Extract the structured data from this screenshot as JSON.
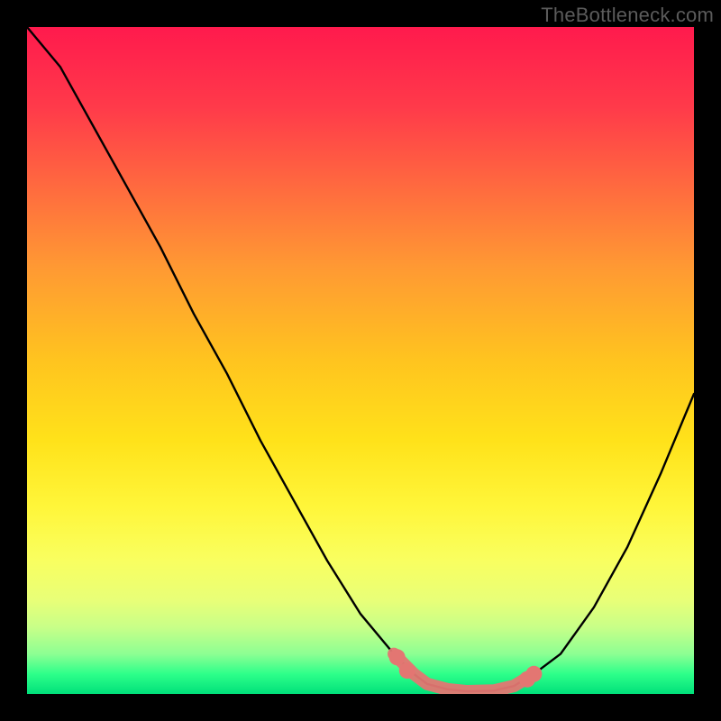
{
  "watermark": "TheBottleneck.com",
  "colors": {
    "frame": "#000000",
    "curve": "#000000",
    "highlight": "#e37672",
    "gradient_stops": [
      "#ff1a4d",
      "#ff3a4a",
      "#ff6a3f",
      "#ff9933",
      "#ffc41f",
      "#ffe21a",
      "#fff63a",
      "#f9ff60",
      "#e8ff78",
      "#c8ff88",
      "#8dff93",
      "#2eff8a",
      "#00e07a"
    ]
  },
  "chart_data": {
    "type": "line",
    "title": "",
    "xlabel": "",
    "ylabel": "",
    "xlim": [
      0,
      100
    ],
    "ylim": [
      0,
      100
    ],
    "series": [
      {
        "name": "bottleneck-curve",
        "x": [
          0,
          5,
          10,
          15,
          20,
          25,
          30,
          35,
          40,
          45,
          50,
          55,
          58,
          60,
          63,
          66,
          70,
          73,
          76,
          80,
          85,
          90,
          95,
          100
        ],
        "y": [
          100,
          94,
          85,
          76,
          67,
          57,
          48,
          38,
          29,
          20,
          12,
          6,
          3,
          1.5,
          0.7,
          0.4,
          0.5,
          1.2,
          3,
          6,
          13,
          22,
          33,
          45
        ]
      }
    ],
    "highlight_segment": {
      "name": "optimal-range",
      "x": [
        55,
        58,
        60,
        63,
        66,
        70,
        73,
        76
      ],
      "y": [
        6,
        3,
        1.5,
        0.7,
        0.4,
        0.5,
        1.2,
        3
      ]
    },
    "highlight_points": {
      "name": "optimal-markers",
      "x": [
        55.5,
        57,
        75,
        76
      ],
      "y": [
        5.5,
        3.5,
        2.2,
        3.0
      ]
    }
  }
}
